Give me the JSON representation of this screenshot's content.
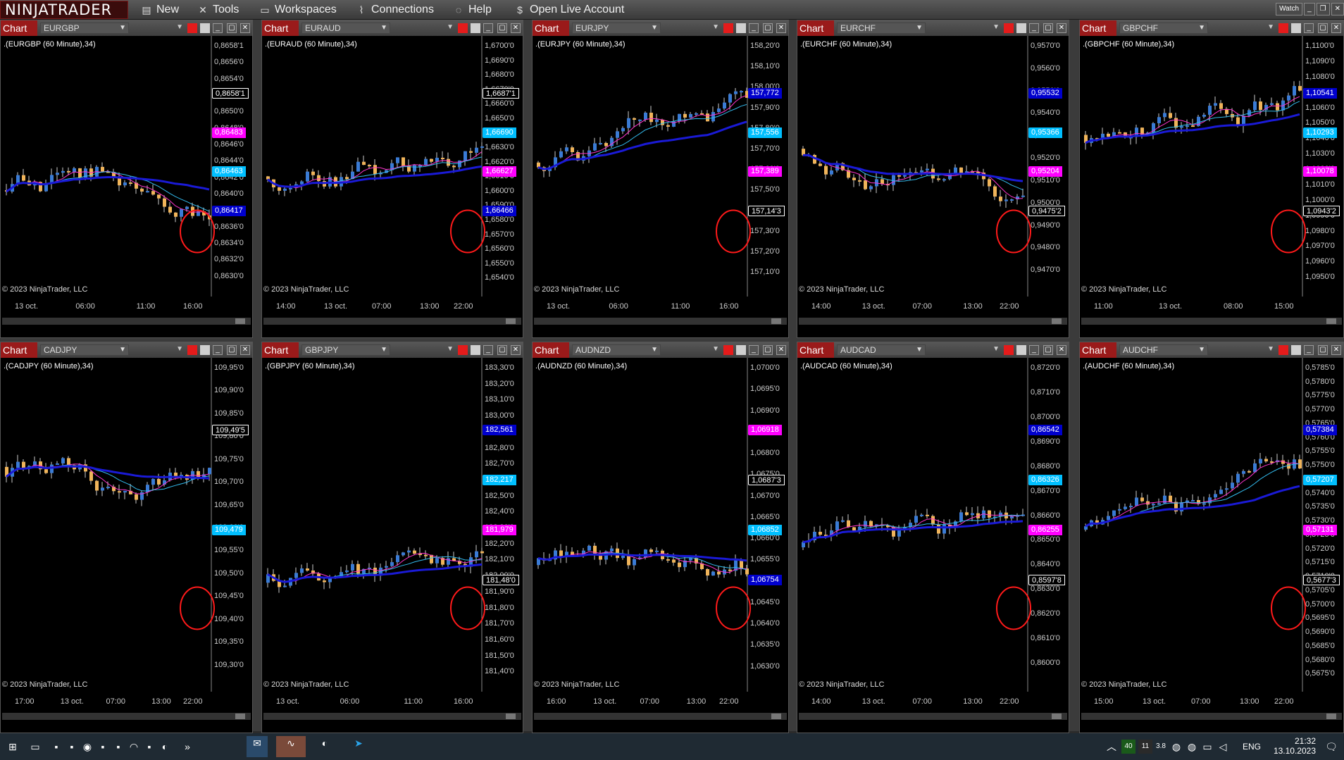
{
  "app": {
    "logo": "NINJATRADER",
    "menu": [
      {
        "label": "New",
        "icon": "folder-icon"
      },
      {
        "label": "Tools",
        "icon": "tools-icon"
      },
      {
        "label": "Workspaces",
        "icon": "workspace-icon"
      },
      {
        "label": "Connections",
        "icon": "plug-icon"
      },
      {
        "label": "Help",
        "icon": "help-icon"
      },
      {
        "label": "Open Live Account",
        "icon": "dollar-icon"
      }
    ],
    "watch_label": "Watch"
  },
  "charts": [
    {
      "tab": "Chart",
      "instrument": "EURGBP",
      "title": ".(EURGBP (60 Minute),34)",
      "copyright": "© 2023 NinjaTrader, LLC",
      "prices": [
        "0,8658'1",
        "0,8656'0",
        "0,8654'0",
        "0,8652'0",
        "0,8650'0",
        "0,8648'0",
        "0,8646'0",
        "0,8644'0",
        "0,8642'0",
        "0,8640'0",
        "0,8638'0",
        "0,8636'0",
        "0,8634'0",
        "0,8632'0",
        "0,8630'0"
      ],
      "times": [
        "13 oct.",
        "06:00",
        "11:00",
        "16:00"
      ],
      "tags": [
        {
          "text": "0,8658'1",
          "color": "#000000"
        },
        {
          "text": "0,86483",
          "color": "#ff00ff"
        },
        {
          "text": "0,86463",
          "color": "#00bfff"
        },
        {
          "text": "0,86417",
          "color": "#0000cd"
        }
      ]
    },
    {
      "tab": "Chart",
      "instrument": "EURAUD",
      "title": ".(EURAUD (60 Minute),34)",
      "copyright": "© 2023 NinjaTrader, LLC",
      "prices": [
        "1,6700'0",
        "1,6690'0",
        "1,6680'0",
        "1,6670'0",
        "1,6660'0",
        "1,6650'0",
        "1,6640'0",
        "1,6630'0",
        "1,6620'0",
        "1,6610'0",
        "1,6600'0",
        "1,6590'0",
        "1,6580'0",
        "1,6570'0",
        "1,6560'0",
        "1,6550'0",
        "1,6540'0"
      ],
      "times": [
        "14:00",
        "13 oct.",
        "07:00",
        "13:00",
        "22:00"
      ],
      "tags": [
        {
          "text": "1,6687'1",
          "color": "#000000"
        },
        {
          "text": "1,66690",
          "color": "#00bfff"
        },
        {
          "text": "1,66627",
          "color": "#ff00ff"
        },
        {
          "text": "1,66466",
          "color": "#0000cd"
        }
      ]
    },
    {
      "tab": "Chart",
      "instrument": "EURJPY",
      "title": ".(EURJPY (60 Minute),34)",
      "copyright": "© 2023 NinjaTrader, LLC",
      "prices": [
        "158,20'0",
        "158,10'0",
        "158,00'0",
        "157,90'0",
        "157,80'0",
        "157,70'0",
        "157,60'0",
        "157,50'0",
        "157,40'0",
        "157,30'0",
        "157,20'0",
        "157,10'0"
      ],
      "times": [
        "13 oct.",
        "06:00",
        "11:00",
        "16:00"
      ],
      "tags": [
        {
          "text": "157,772",
          "color": "#0000cd"
        },
        {
          "text": "157,556",
          "color": "#00bfff"
        },
        {
          "text": "157,389",
          "color": "#ff00ff"
        },
        {
          "text": "157,14'3",
          "color": "#000000"
        }
      ]
    },
    {
      "tab": "Chart",
      "instrument": "EURCHF",
      "title": ".(EURCHF (60 Minute),34)",
      "copyright": "© 2023 NinjaTrader, LLC",
      "prices": [
        "0,9570'0",
        "0,9560'0",
        "0,9550'0",
        "0,9540'0",
        "0,9530'0",
        "0,9520'0",
        "0,9510'0",
        "0,9500'0",
        "0,9490'0",
        "0,9480'0",
        "0,9470'0"
      ],
      "times": [
        "14:00",
        "13 oct.",
        "07:00",
        "13:00",
        "22:00"
      ],
      "tags": [
        {
          "text": "0,95532",
          "color": "#0000cd"
        },
        {
          "text": "0,95366",
          "color": "#00bfff"
        },
        {
          "text": "0,95204",
          "color": "#ff00ff"
        },
        {
          "text": "0,9475'2",
          "color": "#000000"
        }
      ]
    },
    {
      "tab": "Chart",
      "instrument": "GBPCHF",
      "title": ".(GBPCHF (60 Minute),34)",
      "copyright": "© 2023 NinjaTrader, LLC",
      "prices": [
        "1,1100'0",
        "1,1090'0",
        "1,1080'0",
        "1,1070'0",
        "1,1060'0",
        "1,1050'0",
        "1,1040'0",
        "1,1030'0",
        "1,1020'0",
        "1,1010'0",
        "1,1000'0",
        "1,0990'0",
        "1,0980'0",
        "1,0970'0",
        "1,0960'0",
        "1,0950'0"
      ],
      "times": [
        "11:00",
        "13 oct.",
        "08:00",
        "15:00"
      ],
      "tags": [
        {
          "text": "1,10541",
          "color": "#0000cd"
        },
        {
          "text": "1,10293",
          "color": "#00bfff"
        },
        {
          "text": "1,10078",
          "color": "#ff00ff"
        },
        {
          "text": "1,0943'2",
          "color": "#000000"
        }
      ]
    },
    {
      "tab": "Chart",
      "instrument": "CADJPY",
      "title": ".(CADJPY (60 Minute),34)",
      "copyright": "© 2023 NinjaTrader, LLC",
      "prices": [
        "109,95'0",
        "109,90'0",
        "109,85'0",
        "109,80'0",
        "109,75'0",
        "109,70'0",
        "109,65'0",
        "109,60'0",
        "109,55'0",
        "109,50'0",
        "109,45'0",
        "109,40'0",
        "109,35'0",
        "109,30'0"
      ],
      "times": [
        "17:00",
        "13 oct.",
        "07:00",
        "13:00",
        "22:00"
      ],
      "tags": [
        {
          "text": "109,49'5",
          "color": "#000000"
        },
        {
          "text": "109,479",
          "color": "#00bfff"
        }
      ]
    },
    {
      "tab": "Chart",
      "instrument": "GBPJPY",
      "title": ".(GBPJPY (60 Minute),34)",
      "copyright": "© 2023 NinjaTrader, LLC",
      "prices": [
        "183,30'0",
        "183,20'0",
        "183,10'0",
        "183,00'0",
        "182,90'0",
        "182,80'0",
        "182,70'0",
        "182,60'0",
        "182,50'0",
        "182,40'0",
        "182,30'0",
        "182,20'0",
        "182,10'0",
        "182,00'0",
        "181,90'0",
        "181,80'0",
        "181,70'0",
        "181,60'0",
        "181,50'0",
        "181,40'0"
      ],
      "times": [
        "13 oct.",
        "06:00",
        "11:00",
        "16:00"
      ],
      "tags": [
        {
          "text": "182,561",
          "color": "#0000cd"
        },
        {
          "text": "182,217",
          "color": "#00bfff"
        },
        {
          "text": "181,979",
          "color": "#ff00ff"
        },
        {
          "text": "181,48'0",
          "color": "#000000"
        }
      ]
    },
    {
      "tab": "Chart",
      "instrument": "AUDNZD",
      "title": ".(AUDNZD (60 Minute),34)",
      "copyright": "© 2023 NinjaTrader, LLC",
      "prices": [
        "1,0700'0",
        "1,0695'0",
        "1,0690'0",
        "1,0685'0",
        "1,0680'0",
        "1,0675'0",
        "1,0670'0",
        "1,0665'0",
        "1,0660'0",
        "1,0655'0",
        "1,0650'0",
        "1,0645'0",
        "1,0640'0",
        "1,0635'0",
        "1,0630'0"
      ],
      "times": [
        "16:00",
        "13 oct.",
        "07:00",
        "13:00",
        "22:00"
      ],
      "tags": [
        {
          "text": "1,06918",
          "color": "#ff00ff"
        },
        {
          "text": "1,0687'3",
          "color": "#000000"
        },
        {
          "text": "1,06852",
          "color": "#00bfff"
        },
        {
          "text": "1,06754",
          "color": "#0000cd"
        }
      ]
    },
    {
      "tab": "Chart",
      "instrument": "AUDCAD",
      "title": ".(AUDCAD (60 Minute),34)",
      "copyright": "© 2023 NinjaTrader, LLC",
      "prices": [
        "0,8720'0",
        "0,8710'0",
        "0,8700'0",
        "0,8690'0",
        "0,8680'0",
        "0,8670'0",
        "0,8660'0",
        "0,8650'0",
        "0,8640'0",
        "0,8630'0",
        "0,8620'0",
        "0,8610'0",
        "0,8600'0"
      ],
      "times": [
        "14:00",
        "13 oct.",
        "07:00",
        "13:00",
        "22:00"
      ],
      "tags": [
        {
          "text": "0,86542",
          "color": "#0000cd"
        },
        {
          "text": "0,86326",
          "color": "#00bfff"
        },
        {
          "text": "0,86255",
          "color": "#ff00ff"
        },
        {
          "text": "0,8597'8",
          "color": "#000000"
        }
      ]
    },
    {
      "tab": "Chart",
      "instrument": "AUDCHF",
      "title": ".(AUDCHF (60 Minute),34)",
      "copyright": "© 2023 NinjaTrader, LLC",
      "prices": [
        "0,5785'0",
        "0,5780'0",
        "0,5775'0",
        "0,5770'0",
        "0,5765'0",
        "0,5760'0",
        "0,5755'0",
        "0,5750'0",
        "0,5745'0",
        "0,5740'0",
        "0,5735'0",
        "0,5730'0",
        "0,5725'0",
        "0,5720'0",
        "0,5715'0",
        "0,5710'0",
        "0,5705'0",
        "0,5700'0",
        "0,5695'0",
        "0,5690'0",
        "0,5685'0",
        "0,5680'0",
        "0,5675'0"
      ],
      "times": [
        "15:00",
        "13 oct.",
        "07:00",
        "13:00",
        "22:00"
      ],
      "tags": [
        {
          "text": "0,57384",
          "color": "#0000cd"
        },
        {
          "text": "0,57207",
          "color": "#00bfff"
        },
        {
          "text": "0,57131",
          "color": "#ff00ff"
        },
        {
          "text": "0,5677'3",
          "color": "#000000"
        }
      ]
    }
  ],
  "taskbar": {
    "lang": "ENG",
    "time": "21:32",
    "date": "13.10.2023",
    "tray_a": "40",
    "tray_b": "11",
    "tray_c": "3.8"
  }
}
